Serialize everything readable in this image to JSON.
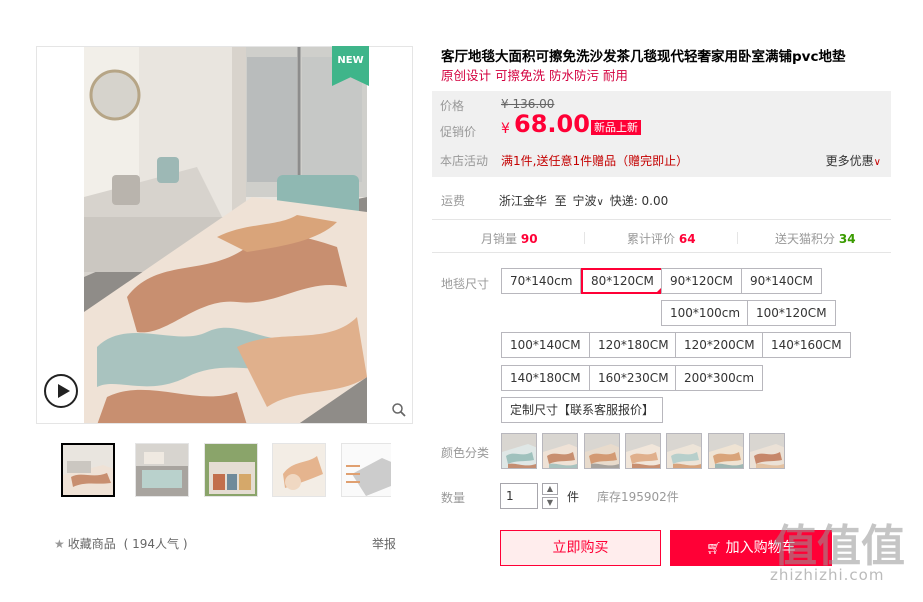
{
  "gallery": {
    "badge": "NEW",
    "thumbnails": [
      "main",
      "detail-1",
      "detail-2",
      "detail-3",
      "detail-4"
    ],
    "favorite_label": "收藏商品",
    "favorite_count": "( 194人气 )",
    "report_label": "举报"
  },
  "product": {
    "title": "客厅地毯大面积可擦免洗沙发茶几毯现代轻奢家用卧室满铺pvc地垫",
    "subtitle": "原创设计 可擦免洗 防水防污 耐用"
  },
  "price": {
    "price_label": "价格",
    "original": "¥ 136.00",
    "promo_label": "促销价",
    "currency": "¥",
    "promo": "68.00",
    "new_tag": "新品上新",
    "activity_label": "本店活动",
    "activity_text": "满1件,送任意1件赠品（赠完即止）",
    "more_label": "更多优惠"
  },
  "shipping": {
    "label": "运费",
    "from": "浙江金华",
    "to_word": "至",
    "to": "宁波",
    "express": "快递: 0.00"
  },
  "stats": {
    "monthly_sales_label": "月销量",
    "monthly_sales": "90",
    "reviews_label": "累计评价",
    "reviews": "64",
    "points_label": "送天猫积分",
    "points": "34"
  },
  "sku": {
    "size_label": "地毯尺寸",
    "sizes": [
      "70*140cm",
      "80*120CM",
      "90*120CM",
      "90*140CM",
      "100*100cm",
      "100*120CM",
      "100*140CM",
      "120*180CM",
      "120*200CM",
      "140*160CM",
      "140*180CM",
      "160*230CM",
      "200*300cm",
      "定制尺寸【联系客服报价】"
    ],
    "selected_size": "80*120CM",
    "color_label": "颜色分类",
    "color_count": 7
  },
  "quantity": {
    "label": "数量",
    "value": "1",
    "unit": "件",
    "stock": "库存195902件"
  },
  "actions": {
    "buy_now": "立即购买",
    "add_cart": "加入购物车"
  },
  "watermark": {
    "glyphs": "值",
    "site": "zhizhizhi.com"
  },
  "colors": {
    "accent": "#ff0036",
    "badge_green": "#3fb58a",
    "price_bg": "#f0f0f0"
  }
}
